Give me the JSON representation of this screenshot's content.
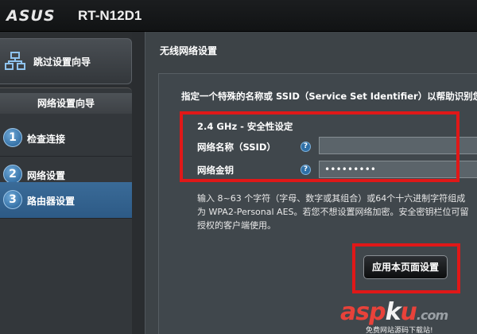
{
  "header": {
    "brand": "ASUS",
    "model": "RT-N12D1"
  },
  "sidebar": {
    "skip_wizard": "跳过设置向导",
    "wizard_title": "网络设置向导",
    "steps": [
      {
        "num": "1",
        "label": "检查连接"
      },
      {
        "num": "2",
        "label": "网络设置"
      },
      {
        "num": "3",
        "label": "路由器设置"
      }
    ]
  },
  "main": {
    "section_title": "无线网络设置",
    "intro": "指定一个特殊的名称或 SSID（Service Set Identifier）以帮助识别您",
    "band_title": "2.4 GHz - 安全性设定",
    "ssid_label": "网络名称（SSID）",
    "ssid_value": "",
    "key_label": "网络金钥",
    "key_value": "•••••••••",
    "help_glyph": "?",
    "note_lines": [
      "输入 8~63 个字符（字母、数字或其组合）或64个十六进制字符组成",
      "为 WPA2-Personal AES。若您不想设置网络加密。安全密钥栏位可留",
      "授权的客户端使用。"
    ],
    "apply_button": "应用本页面设置"
  },
  "watermark": {
    "logo_a": "asp",
    "logo_b": "k",
    "logo_c": "u",
    "logo_d": ".com",
    "sub": "免费网站源码下载站!"
  },
  "colors": {
    "accent": "#2d5a86",
    "annotation": "#e01818",
    "background": "#2a2d30"
  },
  "icons": {
    "skip_wizard": "network-icon",
    "help": "help-icon"
  }
}
